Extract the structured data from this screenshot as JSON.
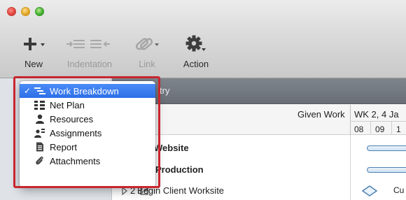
{
  "window": {
    "controls": [
      "close",
      "minimize",
      "zoom"
    ]
  },
  "toolbar": {
    "new_label": "New",
    "indentation_label": "Indentation",
    "link_label": "Link",
    "action_label": "Action"
  },
  "header": {
    "partial_title": "try"
  },
  "columns": {
    "given_work": "Given Work",
    "week": "WK 2, 4 Ja",
    "days": [
      "08",
      "09",
      "1"
    ]
  },
  "rows": [
    {
      "title": "Website",
      "bold": true
    },
    {
      "title": "Production",
      "bold": true
    },
    {
      "number": "2",
      "title": "Begin Client Worksite",
      "gantt_label": "Cu"
    }
  ],
  "menu": {
    "items": [
      {
        "label": "Work Breakdown",
        "icon": "work-breakdown-icon",
        "selected": true
      },
      {
        "label": "Net Plan",
        "icon": "net-plan-icon",
        "selected": false
      },
      {
        "label": "Resources",
        "icon": "person-icon",
        "selected": false
      },
      {
        "label": "Assignments",
        "icon": "assignments-icon",
        "selected": false
      },
      {
        "label": "Report",
        "icon": "report-icon",
        "selected": false
      },
      {
        "label": "Attachments",
        "icon": "paperclip-icon",
        "selected": false
      }
    ],
    "check_mark": "✓"
  },
  "colors": {
    "highlight": "#c8262e",
    "selection": "#2d6fe8",
    "gantt_bar": "#4d7fb0"
  }
}
